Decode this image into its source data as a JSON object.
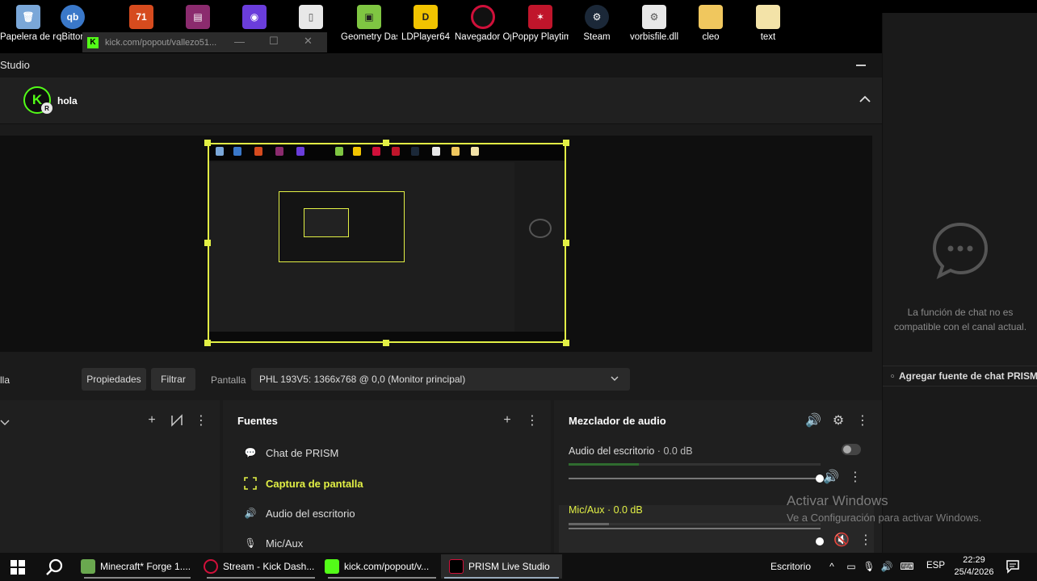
{
  "desktop": {
    "icons": [
      {
        "label": "Papelera de reciclaje",
        "icon": "recycle-bin-icon",
        "color": "#7aa7d8"
      },
      {
        "label": "qBittorrent",
        "icon": "qbittorrent-icon",
        "color": "#3a78c9"
      },
      {
        "label": "",
        "icon": "app-icon",
        "color": "#d64b1e"
      },
      {
        "label": "",
        "icon": "winrar-icon",
        "color": "#8b2b6e"
      },
      {
        "label": "",
        "icon": "app-icon",
        "color": "#6a3ddb"
      },
      {
        "label": "",
        "icon": "file-icon",
        "color": "#e8e8e8"
      },
      {
        "label": "Geometry Dash",
        "icon": "geometry-dash-icon",
        "color": "#7fc642"
      },
      {
        "label": "LDPlayer64",
        "icon": "ldplayer-icon",
        "color": "#f2c400"
      },
      {
        "label": "Navegador Opera GX",
        "icon": "opera-gx-icon",
        "color": "#d0103a"
      },
      {
        "label": "Poppy Playtime",
        "icon": "poppy-playtime-icon",
        "color": "#c0152b"
      },
      {
        "label": "Steam",
        "icon": "steam-icon",
        "color": "#1b2838"
      },
      {
        "label": "vorbisfile.dll",
        "icon": "dll-file-icon",
        "color": "#e8e8e8"
      },
      {
        "label": "cleo",
        "icon": "folder-icon",
        "color": "#f0c75e"
      },
      {
        "label": "text",
        "icon": "folder-icon",
        "color": "#f0c75e"
      }
    ]
  },
  "kick_popout": {
    "url": "kick.com/popout/vallezo51..."
  },
  "studio": {
    "title": "Studio",
    "channel_name": "hola",
    "avatar_letter": "K",
    "avatar_badge": "R",
    "accent": "#e2f045",
    "kick_green": "#53fc18"
  },
  "toolbar": {
    "cut_label": "lla",
    "properties": "Propiedades",
    "filter": "Filtrar",
    "screen_label": "Pantalla",
    "monitor_value": "PHL 193V5: 1366x768 @ 0,0 (Monitor principal)"
  },
  "sources": {
    "title": "Fuentes",
    "items": [
      {
        "label": "Chat de PRISM",
        "icon": "chat-icon",
        "active": false
      },
      {
        "label": "Captura de pantalla",
        "icon": "screen-capture-icon",
        "active": true
      },
      {
        "label": "Audio del escritorio",
        "icon": "speaker-icon",
        "active": false
      },
      {
        "label": "Mic/Aux",
        "icon": "microphone-icon",
        "active": false
      }
    ]
  },
  "mixer": {
    "title": "Mezclador de audio",
    "channels": [
      {
        "name": "Audio del escritorio",
        "db": "0.0 dB",
        "level": 0.28
      },
      {
        "name": "Mic/Aux",
        "db": "0.0 dB",
        "level": 0.16
      }
    ]
  },
  "chat": {
    "message": "La función de chat no es compatible con el canal actual.",
    "add_source": "Agregar fuente de chat PRISM"
  },
  "watermark": {
    "line1": "Activar Windows",
    "line2": "Ve a Configuración para activar Windows."
  },
  "taskbar": {
    "apps": [
      {
        "label": "Minecraft* Forge 1....",
        "color": "#6aa84f"
      },
      {
        "label": "Stream - Kick Dash...",
        "color": "#d0103a"
      },
      {
        "label": "kick.com/popout/v...",
        "color": "#53fc18"
      },
      {
        "label": "PRISM Live Studio",
        "color": "#222222"
      }
    ],
    "tray_label": "Escritorio",
    "lang": "ESP",
    "time": "22:29",
    "date": "25/4/2026"
  }
}
